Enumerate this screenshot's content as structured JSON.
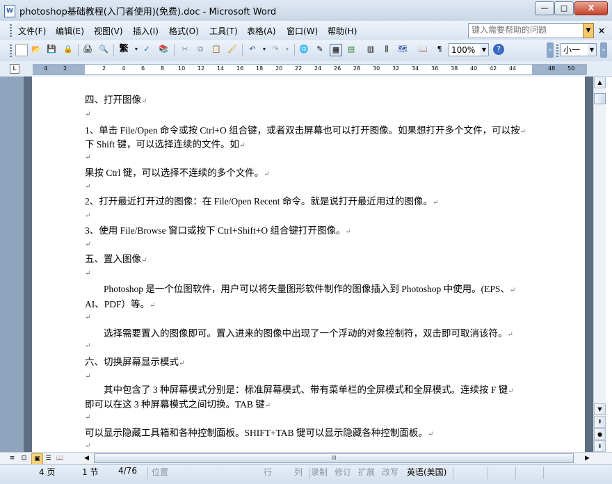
{
  "window": {
    "title": "photoshop基础教程(入门者使用)(免费).doc - Microsoft Word",
    "min_label": "—",
    "max_label": "□",
    "close_label": "X"
  },
  "menu": {
    "items": [
      "文件(F)",
      "编辑(E)",
      "视图(V)",
      "插入(I)",
      "格式(O)",
      "工具(T)",
      "表格(A)",
      "窗口(W)",
      "帮助(H)"
    ],
    "help_placeholder": "键入需要帮助的问题",
    "close_doc": "×"
  },
  "toolbar": {
    "zoom": "100%",
    "font_size": "小一",
    "traditional_char": "繁"
  },
  "ruler": {
    "ticks": [
      "4",
      "2",
      "2",
      "2",
      "4",
      "6",
      "8",
      "10",
      "12",
      "14",
      "16",
      "18",
      "20",
      "22",
      "24",
      "26",
      "28",
      "30",
      "32",
      "34",
      "36",
      "38",
      "40",
      "42",
      "44",
      "48",
      "50"
    ]
  },
  "document": {
    "paragraph_mark": "↵",
    "lines": [
      "四、打开图像",
      "",
      "1、单击 File/Open 命令或按 Ctrl+O 组合键，或者双击屏幕也可以打开图像。如果想打开多个文件，可以按",
      "下 Shift 键，可以选择连续的文件。如",
      "",
      "果按 Ctrl 键，可以选择不连续的多个文件。",
      "",
      "2、打开最近打开过的图像：在 File/Open Recent 命令。就是说打开最近用过的图像。",
      "",
      "3、使用 File/Browse 窗口或按下 Ctrl+Shift+O 组合键打开图像。",
      "",
      "五、置入图像",
      "",
      "        Photoshop 是一个位图软件，用户可以将矢量图形软件制作的图像插入到 Photoshop 中使用。(EPS、",
      "AI、PDF）等。",
      "",
      "        选择需要置入的图像即可。置入进来的图像中出现了一个浮动的对象控制符，双击即可取消该符。",
      "",
      "六、切换屏幕显示模式",
      "",
      "        其中包含了 3 种屏幕模式分别是：标准屏幕模式、带有菜单栏的全屏模式和全屏模式。连续按 F 键",
      "即可以在这 3 种屏幕模式之间切换。TAB 键",
      "",
      "可以显示隐藏工具箱和各种控制面板。SHIFT+TAB 键可以显示隐藏各种控制面板。",
      ""
    ]
  },
  "statusbar": {
    "page": "4 页",
    "section": "1 节",
    "page_of": "4/76",
    "position": "位置",
    "line": "行",
    "column": "列",
    "rec": "录制",
    "trk": "修订",
    "ext": "扩展",
    "ovr": "改写",
    "language": "英语(美国)"
  }
}
